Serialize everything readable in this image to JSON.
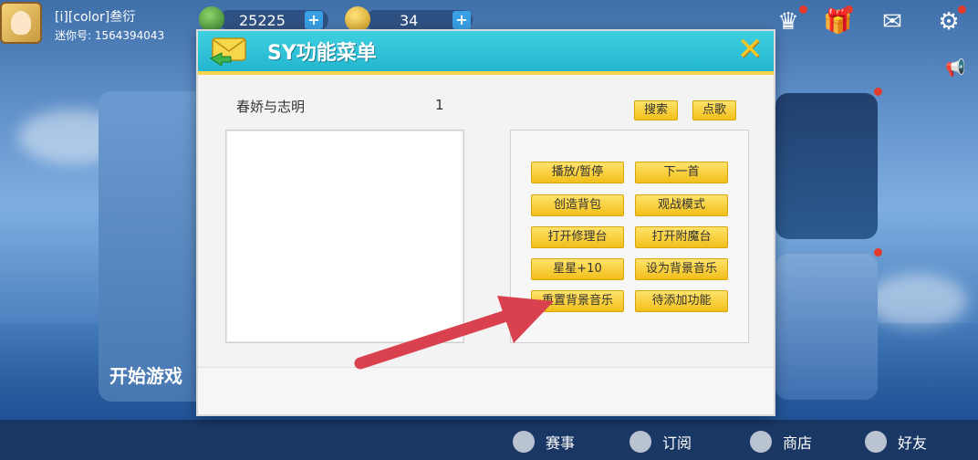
{
  "player": {
    "name": "[i][color]叁衍",
    "id": "迷你号: 1564394043"
  },
  "currencies": {
    "gems": "25225",
    "coins": "34"
  },
  "background": {
    "start_game": "开始游戏"
  },
  "bottom_nav": {
    "items": [
      {
        "label": "赛事"
      },
      {
        "label": "订阅"
      },
      {
        "label": "商店"
      },
      {
        "label": "好友"
      }
    ]
  },
  "dialog": {
    "title": "SY功能菜单",
    "close_label": "✕",
    "song_name": "春娇与志明",
    "song_count": "1",
    "search_label": "搜索",
    "request_label": "点歌",
    "buttons": [
      {
        "label": "播放/暂停"
      },
      {
        "label": "下一首"
      },
      {
        "label": "创造背包"
      },
      {
        "label": "观战模式"
      },
      {
        "label": "打开修理台"
      },
      {
        "label": "打开附魔台"
      },
      {
        "label": "星星+10"
      },
      {
        "label": "设为背景音乐"
      },
      {
        "label": "重置背景音乐"
      },
      {
        "label": "待添加功能"
      }
    ]
  },
  "colors": {
    "header": "#22b6cf",
    "button": "#f2bf1a",
    "arrow": "#d9414e"
  }
}
